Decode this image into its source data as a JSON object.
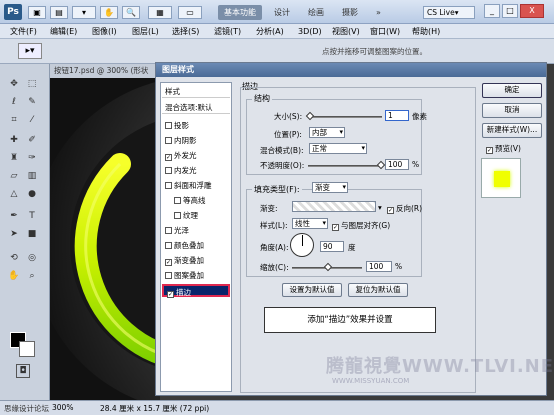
{
  "app": {
    "logo": "Ps",
    "workspace_buttons": [
      "基本功能",
      "设计",
      "绘画",
      "摄影"
    ],
    "workspace_more": "»",
    "cslive": "CS Live▾",
    "window_controls": [
      "_",
      "□",
      "X"
    ]
  },
  "menu": [
    "文件(F)",
    "编辑(E)",
    "图像(I)",
    "图层(L)",
    "选择(S)",
    "滤镜(T)",
    "分析(A)",
    "3D(D)",
    "视图(V)",
    "窗口(W)",
    "帮助(H)"
  ],
  "options_bar": {
    "hint": "点按并拖移可调整图案的位置。"
  },
  "document": {
    "tab": "按钮17.psd @ 300% (形状"
  },
  "status": {
    "zoom": "300%",
    "doc_size": "28.4 厘米 x 15.7 厘米 (72 ppi)",
    "credit": "思缘设计论坛"
  },
  "dialog": {
    "title": "图层样式",
    "style_list": [
      {
        "label": "样式",
        "check": false,
        "head": true
      },
      {
        "label": "混合选项:默认",
        "check": false,
        "head": true
      },
      {
        "label": "投影",
        "check": false
      },
      {
        "label": "内阴影",
        "check": false
      },
      {
        "label": "外发光",
        "check": true
      },
      {
        "label": "内发光",
        "check": false
      },
      {
        "label": "斜面和浮雕",
        "check": false
      },
      {
        "label": "等高线",
        "check": false,
        "indent": true
      },
      {
        "label": "纹理",
        "check": false,
        "indent": true
      },
      {
        "label": "光泽",
        "check": false
      },
      {
        "label": "颜色叠加",
        "check": false
      },
      {
        "label": "渐变叠加",
        "check": true
      },
      {
        "label": "图案叠加",
        "check": false
      },
      {
        "label": "描边",
        "check": true,
        "selected": true
      }
    ],
    "section_title": "描边",
    "structure": {
      "title": "结构",
      "size_label": "大小(S):",
      "size_value": "1",
      "size_unit": "像素",
      "position_label": "位置(P):",
      "position_value": "内部",
      "blend_label": "混合模式(B):",
      "blend_value": "正常",
      "opacity_label": "不透明度(O):",
      "opacity_value": "100",
      "opacity_unit": "%"
    },
    "fill": {
      "type_label": "填充类型(F):",
      "type_value": "渐变",
      "gradient_label": "渐变:",
      "reverse_label": "反向(R)",
      "reverse_checked": true,
      "style_label": "样式(L):",
      "style_value": "线性",
      "align_label": "与图层对齐(G)",
      "align_checked": true,
      "angle_label": "角度(A):",
      "angle_value": "90",
      "angle_unit": "度",
      "scale_label": "缩放(C):",
      "scale_value": "100",
      "scale_unit": "%"
    },
    "buttons": {
      "ok": "确定",
      "cancel": "取消",
      "new_style": "新建样式(W)...",
      "preview": "预览(V)",
      "preview_checked": true,
      "set_default": "设置为默认值",
      "reset_default": "复位为默认值"
    },
    "annotation": "添加“描边”效果并设置",
    "watermark": "腾龍視覺WWW.TLVI.NET",
    "watermark_small": "WWW.MISSYUAN.COM"
  },
  "colors": {
    "accent_yellow": "#d8ff00",
    "selection": "#0a246a",
    "highlight_border": "#e0284f"
  }
}
